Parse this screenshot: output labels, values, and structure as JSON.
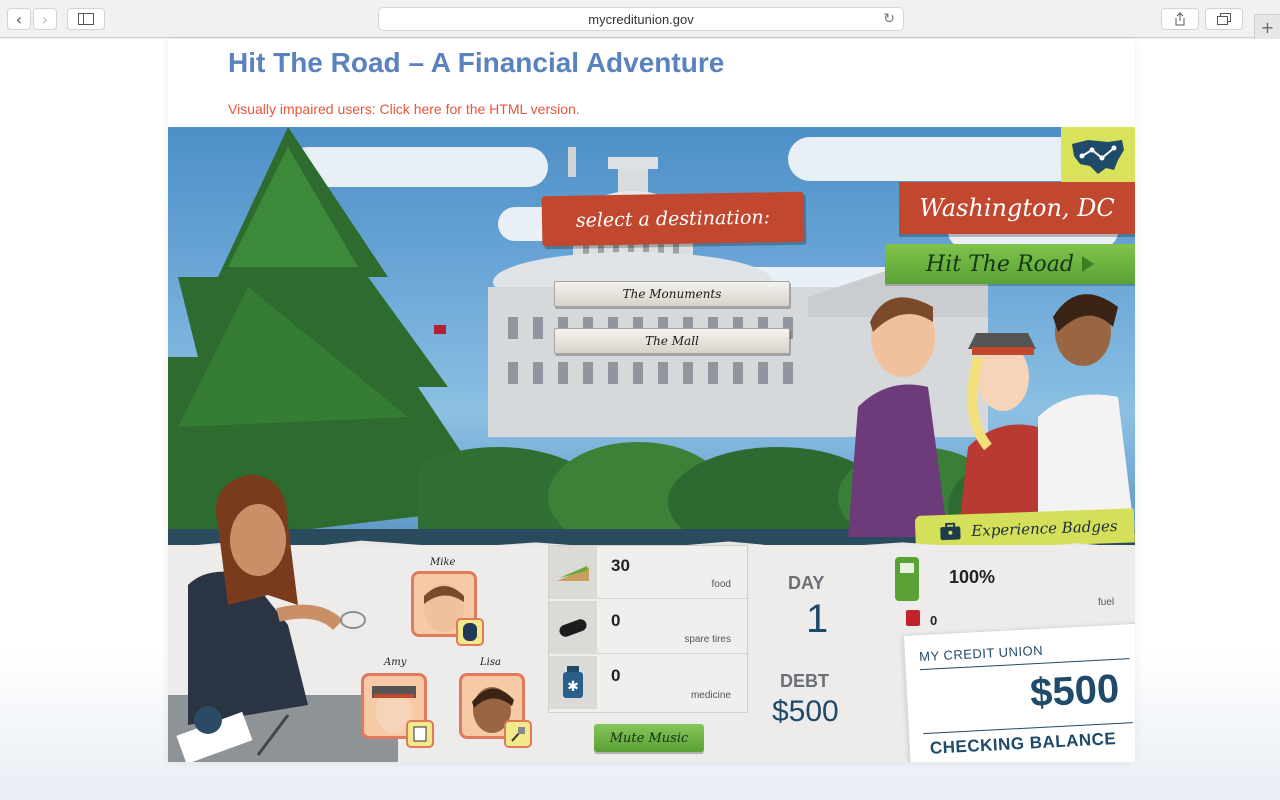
{
  "browser": {
    "url": "mycreditunion.gov"
  },
  "page": {
    "title": "Hit The Road – A Financial Adventure",
    "accessibility_link": "Visually impaired users: Click here for the HTML version."
  },
  "game": {
    "select_destination": "select a destination:",
    "destinations": [
      "The Monuments",
      "The Mall"
    ],
    "city": "Washington, DC",
    "hit_road": "Hit The Road",
    "experience_badges": "Experience Badges",
    "party": [
      "Mike",
      "Amy",
      "Lisa"
    ],
    "supplies": [
      {
        "icon": "sandwich-icon",
        "value": "30",
        "label": "food"
      },
      {
        "icon": "tire-icon",
        "value": "0",
        "label": "spare tires"
      },
      {
        "icon": "medicine-bottle-icon",
        "value": "0",
        "label": "medicine"
      }
    ],
    "mute_music": "Mute Music",
    "day_label": "DAY",
    "day_value": "1",
    "debt_label": "DEBT",
    "debt_value": "$500",
    "fuel_percent": "100%",
    "fuel_label": "fuel",
    "gas_cans": "0",
    "card": {
      "bank_name": "MY CREDIT UNION",
      "amount": "$500",
      "label": "CHECKING BALANCE"
    },
    "colors": {
      "banner_red": "#c1472f",
      "button_green": "#5aa236",
      "title_blue": "#5a82bf",
      "navy": "#1f4a6a"
    }
  }
}
